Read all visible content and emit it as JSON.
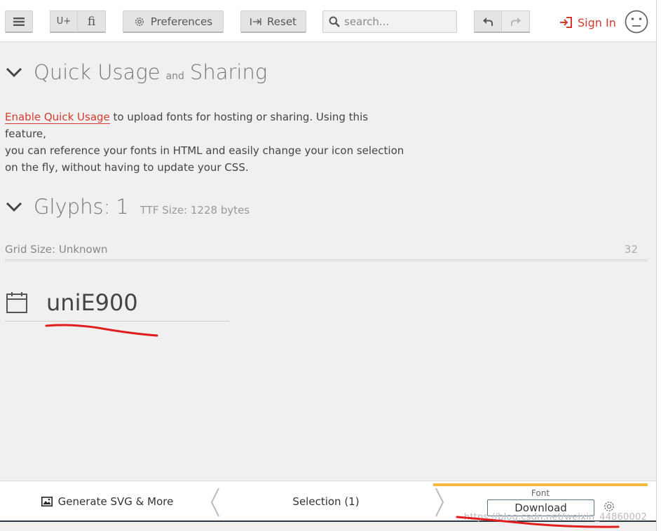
{
  "toolbar": {
    "unicode_label": "U+",
    "ligature_label": "fi",
    "preferences_label": "Preferences",
    "reset_label": "Reset",
    "search_placeholder": "search...",
    "signin_label": "Sign In"
  },
  "quick_usage": {
    "title_part1": "Quick Usage",
    "title_and": "and",
    "title_part2": "Sharing",
    "link_text": "Enable Quick Usage",
    "line1_rest": " to upload fonts for hosting or sharing. Using this feature,",
    "line2": "you can reference your fonts in HTML and easily change your icon selection",
    "line3": "on the fly, without having to update your CSS."
  },
  "glyphs": {
    "title": "Glyphs:",
    "count": "1",
    "ttf_size": "TTF Size: 1228 bytes",
    "grid_size": "Grid Size: Unknown",
    "grid_value": "32",
    "items": [
      {
        "name": "uniE900",
        "icon": "calendar-icon"
      }
    ]
  },
  "bottombar": {
    "generate_label": "Generate SVG & More",
    "selection_label": "Selection (1)",
    "font_label": "Font",
    "download_label": "Download",
    "watermark": "https://blog.csdn.net/weixin_44860002"
  },
  "colors": {
    "accent": "#d43a2f",
    "font_tab": "#f4b940",
    "background": "#f0f0f0"
  }
}
